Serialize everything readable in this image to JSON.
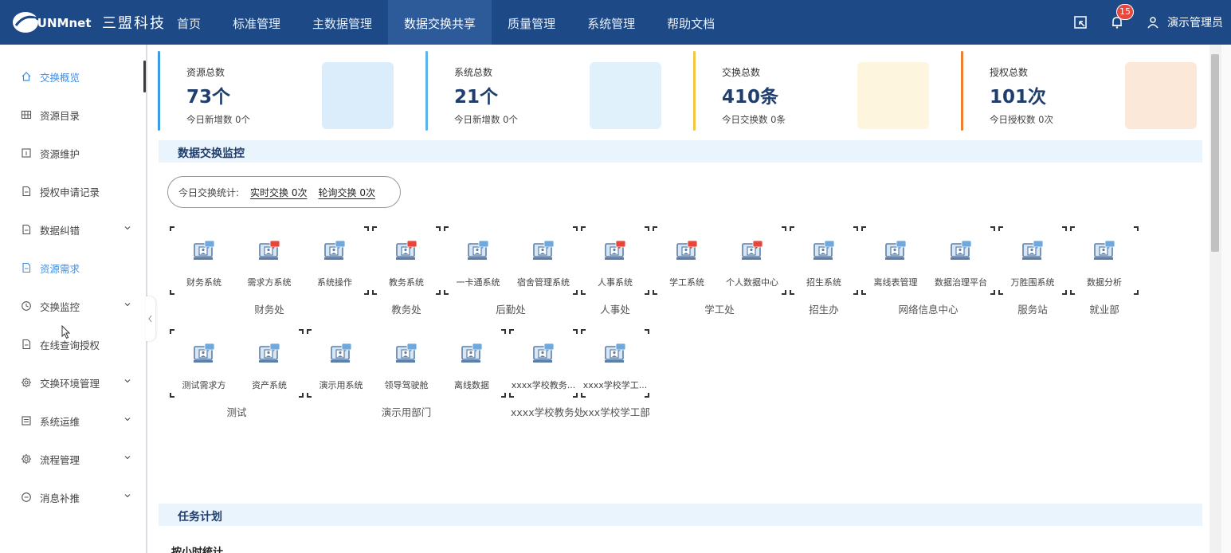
{
  "header": {
    "brand_mark": "SUNMnet",
    "brand_cn": "三盟科技",
    "nav": [
      {
        "label": "首页"
      },
      {
        "label": "标准管理"
      },
      {
        "label": "主数据管理"
      },
      {
        "label": "数据交换共享",
        "active": true
      },
      {
        "label": "质量管理"
      },
      {
        "label": "系统管理"
      },
      {
        "label": "帮助文档"
      }
    ],
    "notification_count": "15",
    "user_name": "演示管理员",
    "bg_color": "#1d4a86"
  },
  "sidebar": {
    "items": [
      {
        "label": "交换概览",
        "icon": "home-icon",
        "active": true,
        "expandable": false
      },
      {
        "label": "资源目录",
        "icon": "grid-icon",
        "expandable": false
      },
      {
        "label": "资源维护",
        "icon": "square-info-icon",
        "expandable": false
      },
      {
        "label": "授权申请记录",
        "icon": "document-icon",
        "expandable": false
      },
      {
        "label": "数据纠错",
        "icon": "document-icon",
        "expandable": true
      },
      {
        "label": "资源需求",
        "icon": "document-icon",
        "active_text": true,
        "expandable": false
      },
      {
        "label": "交换监控",
        "icon": "clock-icon",
        "expandable": true
      },
      {
        "label": "在线查询授权",
        "icon": "document-icon",
        "expandable": false
      },
      {
        "label": "交换环境管理",
        "icon": "gear-icon",
        "expandable": true
      },
      {
        "label": "系统运维",
        "icon": "list-icon",
        "expandable": true
      },
      {
        "label": "流程管理",
        "icon": "gear-icon",
        "expandable": true
      },
      {
        "label": "消息补推",
        "icon": "message-icon",
        "expandable": true
      }
    ]
  },
  "stats": [
    {
      "label": "资源总数",
      "value": "73个",
      "sub": "今日新增数 0个",
      "color": "#3a9ce6"
    },
    {
      "label": "系统总数",
      "value": "21个",
      "sub": "今日新增数 0个",
      "color": "#5ab4e8"
    },
    {
      "label": "交换总数",
      "value": "410条",
      "sub": "今日交换数 0条",
      "color": "#f5c542"
    },
    {
      "label": "授权总数",
      "value": "101次",
      "sub": "今日授权数 0次",
      "color": "#ee7d2e"
    }
  ],
  "monitor": {
    "title": "数据交换监控",
    "today_label": "今日交换统计:",
    "realtime": "实时交换 0次",
    "polling": "轮询交换 0次",
    "departments": [
      {
        "name": "财务处",
        "systems": [
          {
            "name": "财务系统",
            "alert": false
          },
          {
            "name": "需求方系统",
            "alert": true
          },
          {
            "name": "系统操作",
            "alert": false
          }
        ]
      },
      {
        "name": "教务处",
        "systems": [
          {
            "name": "教务系统",
            "alert": true
          }
        ]
      },
      {
        "name": "后勤处",
        "systems": [
          {
            "name": "一卡通系统",
            "alert": false
          },
          {
            "name": "宿舍管理系统",
            "alert": false
          }
        ]
      },
      {
        "name": "人事处",
        "systems": [
          {
            "name": "人事系统",
            "alert": true
          }
        ]
      },
      {
        "name": "学工处",
        "systems": [
          {
            "name": "学工系统",
            "alert": true
          },
          {
            "name": "个人数据中心",
            "alert": true
          }
        ]
      },
      {
        "name": "招生办",
        "systems": [
          {
            "name": "招生系统",
            "alert": false
          }
        ]
      },
      {
        "name": "网络信息中心",
        "systems": [
          {
            "name": "离线表管理",
            "alert": false
          },
          {
            "name": "数据治理平台",
            "alert": false
          }
        ]
      },
      {
        "name": "服务站",
        "systems": [
          {
            "name": "万胜围系统",
            "alert": false
          }
        ]
      },
      {
        "name": "就业部",
        "systems": [
          {
            "name": "数据分析",
            "alert": false
          }
        ]
      },
      {
        "name": "测试",
        "systems": [
          {
            "name": "测试需求方",
            "alert": false
          },
          {
            "name": "资产系统",
            "alert": false
          }
        ]
      },
      {
        "name": "演示用部门",
        "systems": [
          {
            "name": "演示用系统",
            "alert": false
          },
          {
            "name": "领导驾驶舱",
            "alert": false
          },
          {
            "name": "离线数据",
            "alert": false
          }
        ]
      },
      {
        "name": "xxxx学校教务处",
        "systems": [
          {
            "name": "xxxx学校教务...",
            "alert": false
          }
        ]
      },
      {
        "name": "xxx学校学工部",
        "systems": [
          {
            "name": "xxxx学校学工...",
            "alert": false
          }
        ]
      }
    ]
  },
  "tasks": {
    "title": "任务计划",
    "hourly_title": "按小时统计"
  }
}
